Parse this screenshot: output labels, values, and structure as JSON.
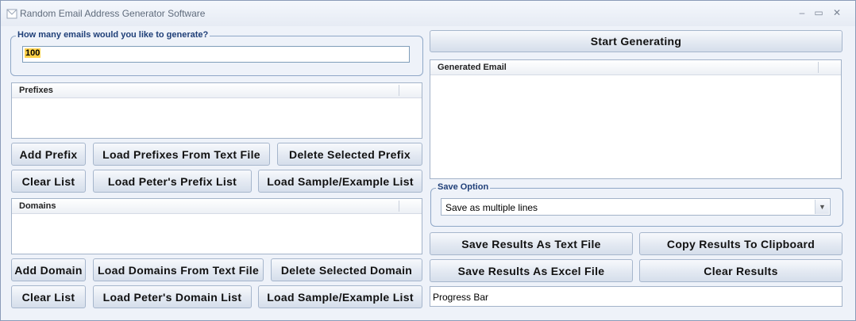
{
  "window": {
    "title": "Random Email Address Generator Software",
    "minimize": "‒",
    "maximize": "▭",
    "close": "✕"
  },
  "count": {
    "label": "How many emails would you like to generate?",
    "value": "100"
  },
  "prefixes": {
    "header": "Prefixes",
    "buttons": {
      "add": "Add Prefix",
      "load_file": "Load Prefixes From Text File",
      "delete": "Delete Selected Prefix",
      "clear": "Clear List",
      "load_peter": "Load Peter's Prefix List",
      "load_sample": "Load Sample/Example List"
    }
  },
  "domains": {
    "header": "Domains",
    "buttons": {
      "add": "Add Domain",
      "load_file": "Load Domains From Text File",
      "delete": "Delete Selected Domain",
      "clear": "Clear List",
      "load_peter": "Load Peter's Domain List",
      "load_sample": "Load Sample/Example List"
    }
  },
  "generate": {
    "start_button": "Start Generating",
    "results_header": "Generated Email"
  },
  "save": {
    "label": "Save Option",
    "selected": "Save as multiple lines",
    "buttons": {
      "text_file": "Save Results As Text File",
      "clipboard": "Copy Results To Clipboard",
      "excel": "Save Results As Excel File",
      "clear": "Clear Results"
    }
  },
  "progress": {
    "label": "Progress Bar"
  }
}
